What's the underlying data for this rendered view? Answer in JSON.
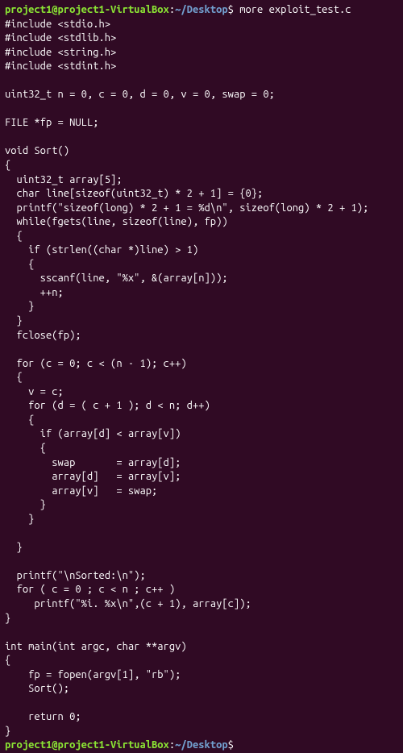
{
  "prompt": {
    "user_host": "project1@project1-VirtualBox",
    "colon": ":",
    "path": "~/Desktop",
    "dollar": "$ ",
    "command": "more exploit_test.c"
  },
  "code_lines": [
    "#include <stdio.h>",
    "#include <stdlib.h>",
    "#include <string.h>",
    "#include <stdint.h>",
    "",
    "uint32_t n = 0, c = 0, d = 0, v = 0, swap = 0;",
    "",
    "FILE *fp = NULL;",
    "",
    "void Sort()",
    "{",
    "  uint32_t array[5];",
    "  char line[sizeof(uint32_t) * 2 + 1] = {0};",
    "  printf(\"sizeof(long) * 2 + 1 = %d\\n\", sizeof(long) * 2 + 1);",
    "  while(fgets(line, sizeof(line), fp))",
    "  {",
    "    if (strlen((char *)line) > 1)",
    "    {",
    "      sscanf(line, \"%x\", &(array[n]));",
    "      ++n;",
    "    }",
    "  }",
    "  fclose(fp);",
    "",
    "  for (c = 0; c < (n - 1); c++)",
    "  {",
    "    v = c;",
    "    for (d = ( c + 1 ); d < n; d++)",
    "    {",
    "      if (array[d] < array[v])",
    "      {",
    "        swap       = array[d];",
    "        array[d]   = array[v];",
    "        array[v]   = swap;",
    "      }",
    "    }",
    "",
    "  }",
    "",
    "  printf(\"\\nSorted:\\n\");",
    "  for ( c = 0 ; c < n ; c++ )",
    "     printf(\"%i. %x\\n\",(c + 1), array[c]);",
    "}",
    "",
    "int main(int argc, char **argv)",
    "{",
    "    fp = fopen(argv[1], \"rb\");",
    "    Sort();",
    "",
    "    return 0;",
    "}"
  ],
  "bottom_prompt": {
    "user_host": "project1@project1-VirtualBox",
    "colon": ":",
    "path": "~/Desktop",
    "dollar": "$ "
  }
}
